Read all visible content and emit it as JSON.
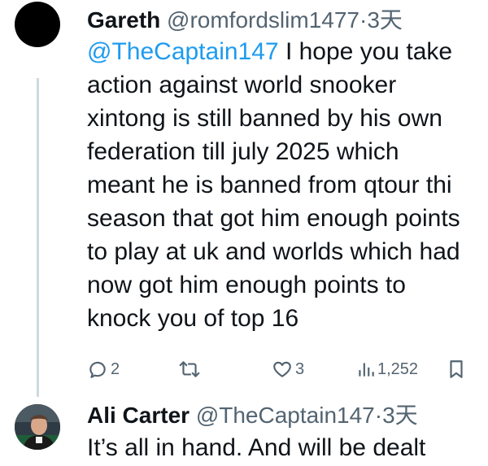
{
  "tweets": [
    {
      "display_name": "Gareth",
      "handle": "@romfordslim1477",
      "dot": "·",
      "time": "3天",
      "mention": "@TheCaptain147",
      "text_lines": [
        " I hope you take",
        "action against world snooker",
        "xintong is still banned by his own",
        "federation till july 2025 which",
        "meant he is banned from qtour thi",
        "season that got him enough points",
        "to play at uk and worlds which had",
        "now got him enough points to",
        "knock you of top 16"
      ],
      "actions": {
        "reply_count": "2",
        "retweet_count": "",
        "like_count": "3",
        "views_count": "1,252"
      }
    },
    {
      "display_name": "Ali Carter",
      "handle": "@TheCaptain147",
      "dot": "·",
      "time": "3天",
      "text_lines": [
        "It’s all in hand. And will be dealt"
      ]
    }
  ],
  "icons": {
    "reply": "reply-icon",
    "retweet": "retweet-icon",
    "like": "heart-icon",
    "views": "views-icon",
    "bookmark": "bookmark-icon"
  },
  "colors": {
    "accent": "#1d9bf0",
    "secondary_text": "#536471",
    "primary_text": "#0f1419",
    "thread_line": "#cfd9de"
  }
}
